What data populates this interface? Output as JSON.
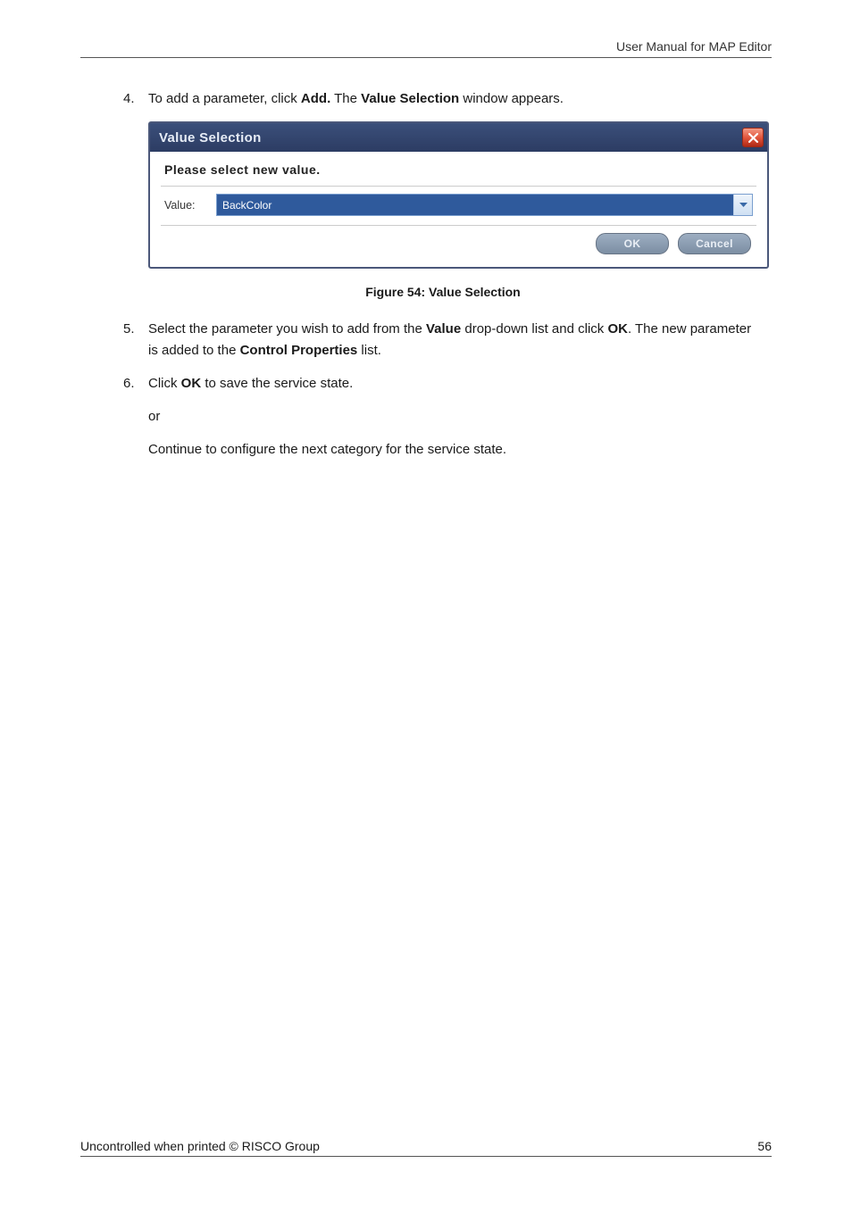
{
  "header": {
    "right_text": "User Manual for MAP Editor"
  },
  "steps": [
    {
      "num": "4.",
      "parts": [
        "To add a parameter, click ",
        "Add.",
        " The ",
        "Value Selection",
        " window appears."
      ]
    },
    {
      "num": "5.",
      "parts": [
        "Select the parameter you wish to add from the ",
        "Value",
        " drop-down list and click ",
        "OK",
        ". The new parameter is added to the ",
        "Control Properties",
        " list."
      ]
    },
    {
      "num": "6.",
      "parts": [
        "Click ",
        "OK",
        " to save the service state."
      ]
    }
  ],
  "or_text": "or",
  "continue_text": "Continue to configure the next category for the service state.",
  "dialog": {
    "title": "Value Selection",
    "heading": "Please select new value.",
    "field_label": "Value:",
    "selected_value": "BackColor",
    "ok_label": "OK",
    "cancel_label": "Cancel"
  },
  "figure_caption": "Figure 54: Value Selection",
  "footer": {
    "left": "Uncontrolled when printed © RISCO Group",
    "right": "56"
  }
}
